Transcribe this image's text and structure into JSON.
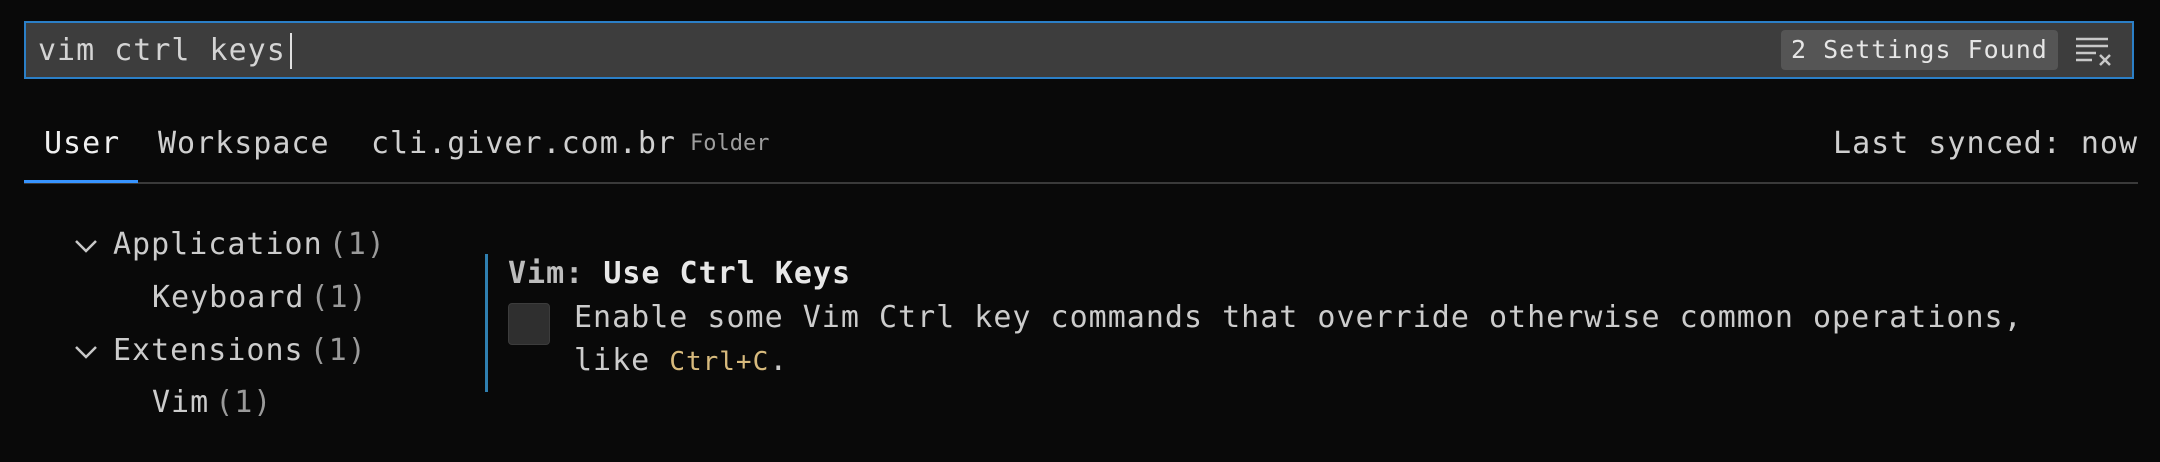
{
  "search": {
    "value": "vim ctrl keys",
    "results_badge": "2 Settings Found",
    "clear_icon": "clear-filter-icon"
  },
  "tabs": [
    {
      "label": "User",
      "active": true
    },
    {
      "label": "Workspace",
      "active": false
    },
    {
      "label": "cli.giver.com.br",
      "active": false,
      "sub_label": "Folder"
    }
  ],
  "sync_status": "Last synced: now",
  "tree": {
    "application": {
      "label": "Application",
      "count": "(1)"
    },
    "keyboard": {
      "label": "Keyboard",
      "count": "(1)"
    },
    "extensions": {
      "label": "Extensions",
      "count": "(1)"
    },
    "vim": {
      "label": "Vim",
      "count": "(1)"
    }
  },
  "setting": {
    "category": "Vim: ",
    "name": "Use Ctrl Keys",
    "checked": false,
    "description_before": "Enable some Vim Ctrl key commands that override otherwise common operations, like ",
    "description_code": "Ctrl+C",
    "description_after": "."
  },
  "colors": {
    "accent_border": "#2b7fc7",
    "tab_underline": "#3794ff",
    "setting_indicator": "#2f7fb0",
    "code_text": "#d7ba7d"
  }
}
